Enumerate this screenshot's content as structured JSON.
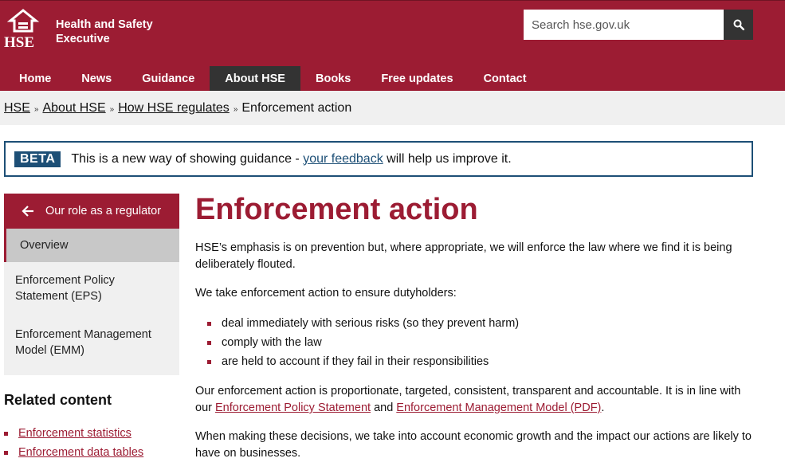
{
  "header": {
    "logo_text": "HSE",
    "org_name_line1": "Health and Safety",
    "org_name_line2": "Executive",
    "search_placeholder": "Search hse.gov.uk"
  },
  "nav": {
    "items": [
      {
        "label": "Home",
        "active": false
      },
      {
        "label": "News",
        "active": false
      },
      {
        "label": "Guidance",
        "active": false
      },
      {
        "label": "About HSE",
        "active": true
      },
      {
        "label": "Books",
        "active": false
      },
      {
        "label": "Free updates",
        "active": false
      },
      {
        "label": "Contact",
        "active": false
      }
    ]
  },
  "breadcrumb": {
    "items": [
      "HSE",
      "About HSE",
      "How HSE regulates"
    ],
    "separator": "»",
    "current": "Enforcement action"
  },
  "beta": {
    "tag": "BETA",
    "text_before": "This is a new way of showing guidance - ",
    "link": "your feedback",
    "text_after": " will help us improve it."
  },
  "sidenav": {
    "header": "Our role as a regulator",
    "items": [
      {
        "label": "Overview",
        "active": true
      },
      {
        "label": "Enforcement Policy Statement (EPS)",
        "active": false
      },
      {
        "label": "Enforcement Management Model (EMM)",
        "active": false
      }
    ]
  },
  "related": {
    "title": "Related content",
    "links": [
      "Enforcement statistics",
      "Enforcement data tables"
    ]
  },
  "main": {
    "title": "Enforcement action",
    "p1": "HSE’s emphasis is on prevention but, where appropriate, we will enforce the law where we find it is being deliberately flouted.",
    "p2": "We take enforcement action to ensure dutyholders:",
    "list": [
      "deal immediately with serious risks (so they prevent harm)",
      "comply with the law",
      "are held to account if they fail in their responsibilities"
    ],
    "p3_before": "Our enforcement action is proportionate, targeted, consistent, transparent and accountable. It is in line with our ",
    "p3_link1": "Enforcement Policy Statement",
    "p3_mid": " and ",
    "p3_link2": "Enforcement Management Model (PDF)",
    "p3_after": ".",
    "p4": "When making these decisions, we take into account economic growth and the impact our actions are likely to have on businesses."
  },
  "colors": {
    "brand": "#9c1c33",
    "beta": "#1d4f76",
    "nav_active": "#333333"
  }
}
